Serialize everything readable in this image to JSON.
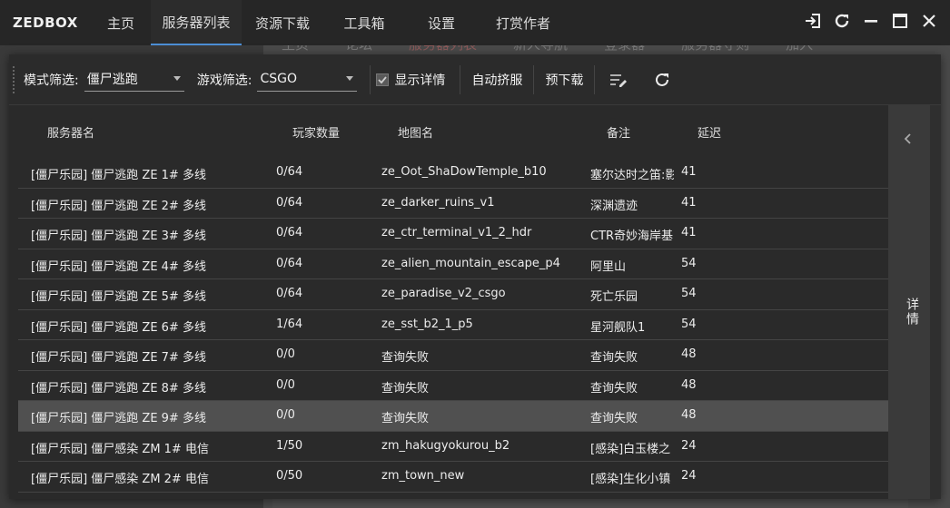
{
  "app": {
    "brand": "ZEDBOX",
    "tabs": [
      {
        "label": "主页"
      },
      {
        "label": "服务器列表"
      },
      {
        "label": "资源下载"
      },
      {
        "label": "工具箱"
      },
      {
        "label": "设置"
      },
      {
        "label": "打赏作者"
      }
    ],
    "active_tab": 1,
    "accent_color": "#4d8fd6"
  },
  "background_site": {
    "nav": [
      "主页",
      "论坛",
      "服务器列表",
      "新人导航",
      "登录器",
      "服务器守则",
      "加入"
    ]
  },
  "toolbar": {
    "mode_label": "模式筛选:",
    "mode_value": "僵尸逃跑",
    "game_label": "游戏筛选:",
    "game_value": "CSGO",
    "show_detail_label": "显示详情",
    "show_detail_checked": true,
    "auto_squeeze_label": "自动挤服",
    "predownload_label": "预下载"
  },
  "table": {
    "headers": {
      "name": "服务器名",
      "players": "玩家数量",
      "map": "地图名",
      "note": "备注",
      "ping": "延迟"
    },
    "rows": [
      {
        "name": "[僵尸乐园] 僵尸逃跑 ZE 1# 多线",
        "players": "0/64",
        "map": "ze_Oot_ShaDowTemple_b10",
        "note": "塞尔达时之笛:影",
        "ping": "41"
      },
      {
        "name": "[僵尸乐园] 僵尸逃跑 ZE 2# 多线",
        "players": "0/64",
        "map": "ze_darker_ruins_v1",
        "note": "深渊遗迹",
        "ping": "41"
      },
      {
        "name": "[僵尸乐园] 僵尸逃跑 ZE 3# 多线",
        "players": "0/64",
        "map": "ze_ctr_terminal_v1_2_hdr",
        "note": "CTR奇妙海岸基",
        "ping": "41"
      },
      {
        "name": "[僵尸乐园] 僵尸逃跑 ZE 4# 多线",
        "players": "0/64",
        "map": "ze_alien_mountain_escape_p4",
        "note": "阿里山",
        "ping": "54"
      },
      {
        "name": "[僵尸乐园] 僵尸逃跑 ZE 5# 多线",
        "players": "0/64",
        "map": "ze_paradise_v2_csgo",
        "note": "死亡乐园",
        "ping": "54"
      },
      {
        "name": "[僵尸乐园] 僵尸逃跑 ZE 6# 多线",
        "players": "1/64",
        "map": "ze_sst_b2_1_p5",
        "note": "星河舰队1",
        "ping": "54"
      },
      {
        "name": "[僵尸乐园] 僵尸逃跑 ZE 7# 多线",
        "players": "0/0",
        "map": "查询失败",
        "note": "查询失败",
        "ping": "48"
      },
      {
        "name": "[僵尸乐园] 僵尸逃跑 ZE 8# 多线",
        "players": "0/0",
        "map": "查询失败",
        "note": "查询失败",
        "ping": "48"
      },
      {
        "name": "[僵尸乐园] 僵尸逃跑 ZE 9# 多线",
        "players": "0/0",
        "map": "查询失败",
        "note": "查询失败",
        "ping": "48"
      },
      {
        "name": "[僵尸乐园] 僵尸感染 ZM 1# 电信",
        "players": "1/50",
        "map": "zm_hakugyokurou_b2",
        "note": "[感染]白玉楼之",
        "ping": "24"
      },
      {
        "name": "[僵尸乐园] 僵尸感染 ZM 2# 电信",
        "players": "0/50",
        "map": "zm_town_new",
        "note": "[感染]生化小镇",
        "ping": "24"
      }
    ],
    "selected_row": 8
  },
  "side_panel": {
    "label": "详情"
  }
}
